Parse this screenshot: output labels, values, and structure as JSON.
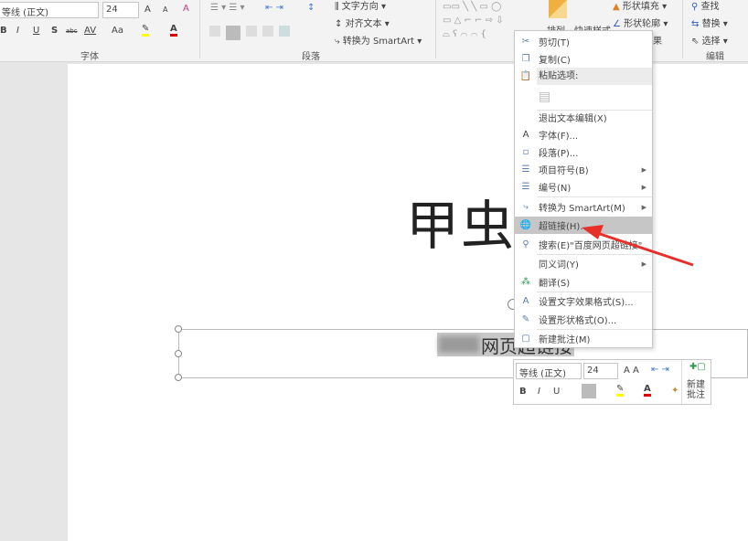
{
  "ribbon": {
    "font_group": {
      "label": "字体",
      "font_name": "等线 (正文)",
      "font_size": "24",
      "bold": "B",
      "italic": "I",
      "underline": "U",
      "shadow": "S",
      "strike": "abc",
      "spacing": "AV",
      "case": "Aa",
      "grow": "A",
      "shrink": "A"
    },
    "paragraph_group": {
      "label": "段落",
      "text_direction": "文字方向",
      "align_text": "对齐文本",
      "convert_smartart": "转换为 SmartArt"
    },
    "drawing_group": {
      "arrange": "排列",
      "quick_styles": "快速样式",
      "shape_fill": "形状填充",
      "shape_outline": "形状轮廓",
      "shape_effects": "果"
    },
    "editing_group": {
      "label": "编辑",
      "find": "查找",
      "replace": "替换",
      "select": "选择"
    }
  },
  "slide": {
    "title": "甲虫",
    "textbox_text": "网页超链接"
  },
  "context_menu": {
    "items": [
      {
        "label": "剪切(T)",
        "icon": "scissors-icon"
      },
      {
        "label": "复制(C)",
        "icon": "copy-icon"
      },
      {
        "label": "粘贴选项:",
        "icon": "paste-icon"
      },
      {
        "label": "",
        "icon": "paste-keep-text-icon"
      },
      {
        "label": "退出文本编辑(X)",
        "icon": ""
      },
      {
        "label": "字体(F)...",
        "icon": "font-icon"
      },
      {
        "label": "段落(P)...",
        "icon": "paragraph-icon"
      },
      {
        "label": "项目符号(B)",
        "icon": "bullets-icon"
      },
      {
        "label": "编号(N)",
        "icon": "numbering-icon"
      },
      {
        "label": "转换为 SmartArt(M)",
        "icon": "smartart-icon"
      },
      {
        "label": "超链接(H)...",
        "icon": "hyperlink-icon"
      },
      {
        "label": "搜索(E)\"百度网页超链接\"",
        "icon": "search-icon"
      },
      {
        "label": "同义词(Y)",
        "icon": ""
      },
      {
        "label": "翻译(S)",
        "icon": "translate-icon"
      },
      {
        "label": "设置文字效果格式(S)...",
        "icon": "text-effects-icon"
      },
      {
        "label": "设置形状格式(O)...",
        "icon": "shape-format-icon"
      },
      {
        "label": "新建批注(M)",
        "icon": "comment-icon"
      }
    ]
  },
  "mini_toolbar": {
    "font_name": "等线 (正文)",
    "font_size": "24",
    "bold": "B",
    "italic": "I",
    "underline": "U",
    "new_comment": "新建\n批注"
  },
  "colors": {
    "highlight": "#ffff00",
    "font_color": "#e00000",
    "arrow": "#e8302a",
    "menu_highlight": "#c6c6c6"
  }
}
